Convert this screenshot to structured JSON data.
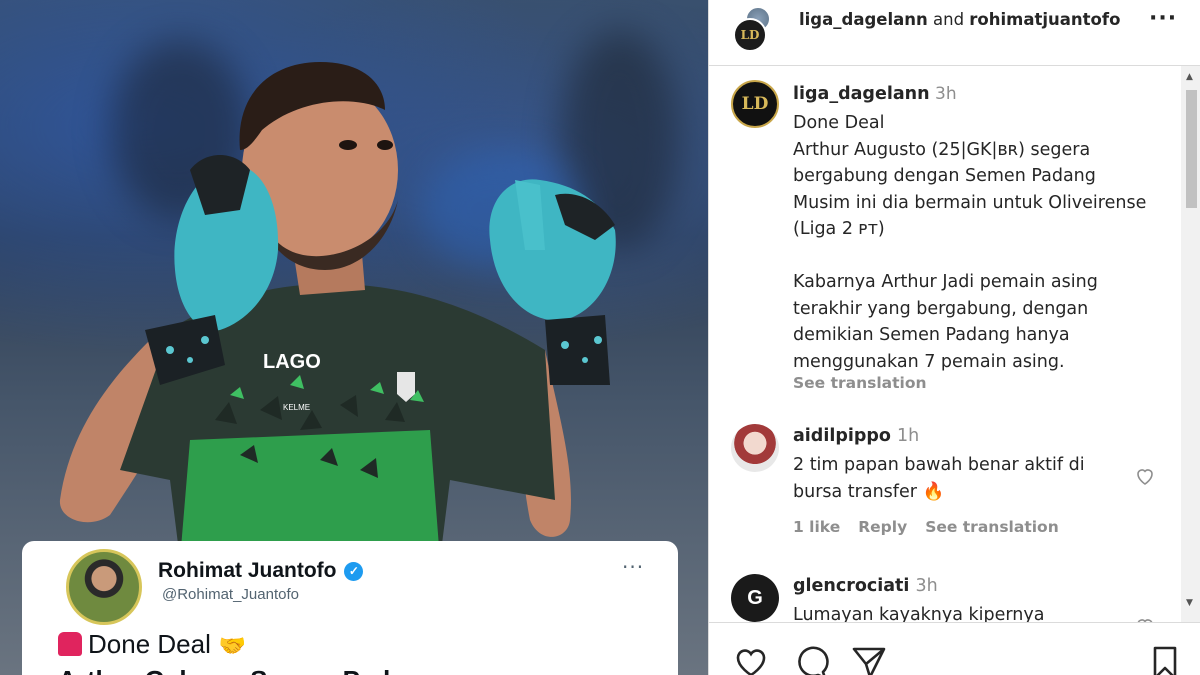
{
  "tweet": {
    "name": "Rohimat Juantofo",
    "handle": "@Rohimat_Juantofo",
    "more": "···",
    "line1": "Done Deal",
    "line2": "Arthur Gabung Semen Padang"
  },
  "photo": {
    "jersey_brand": "LAGO",
    "kit_brand": "KELME"
  },
  "instagram": {
    "header": {
      "user1": "liga_dagelann",
      "joiner": "and",
      "user2": "rohimatjuantofo",
      "more": "···"
    },
    "post": {
      "logo_text": "LD",
      "username": "liga_dagelann",
      "time": "3h",
      "caption": "Done Deal\nArthur Augusto (25|GK|ʙʀ) segera bergabung dengan Semen Padang\nMusim ini dia bermain untuk Oliveirense (Liga 2 ᴘᴛ)\n\nKabarnya Arthur Jadi pemain asing terakhir yang bergabung, dengan demikian Semen Padang hanya menggunakan 7 pemain asing.",
      "see_translation": "See translation"
    },
    "comments": [
      {
        "username": "aidilpippo",
        "time": "1h",
        "text": "2 tim papan bawah benar aktif di bursa transfer 🔥",
        "likes": "1 like",
        "reply": "Reply",
        "see_translation": "See translation"
      },
      {
        "username": "glencrociati",
        "time": "3h",
        "text": "Lumayan kayaknya kipernya"
      }
    ],
    "colors": {
      "text": "#262626",
      "muted": "#8e8e8e",
      "border": "#dbdbdb"
    }
  }
}
